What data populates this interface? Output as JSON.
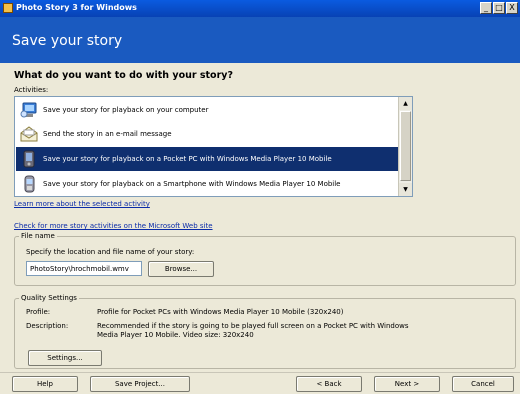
{
  "window": {
    "title": "Photo Story 3 for Windows",
    "controls": {
      "minimize": "_",
      "maximize": "□",
      "close": "X"
    }
  },
  "header": {
    "title": "Save your story"
  },
  "main": {
    "heading": "What do you want to do with your story?",
    "activities_label": "Activities:",
    "activities": [
      {
        "label": "Save your story for playback on your computer",
        "icon": "computer-icon",
        "selected": false
      },
      {
        "label": "Send the story in an e-mail message",
        "icon": "email-icon",
        "selected": false
      },
      {
        "label": "Save your story for playback on a Pocket PC with Windows Media Player 10 Mobile",
        "icon": "pocket-pc-icon",
        "selected": true
      },
      {
        "label": "Save your story for playback on a Smartphone with Windows Media Player 10 Mobile",
        "icon": "smartphone-icon",
        "selected": false
      }
    ],
    "learn_more_link": "Learn more about the selected activity",
    "check_more_link": "Check for more story activities on the Microsoft Web site"
  },
  "file_name": {
    "legend": "File name",
    "instruction": "Specify the location and file name of your story:",
    "value": "PhotoStory\\hrochmobil.wmv",
    "browse_label": "Browse..."
  },
  "quality": {
    "legend": "Quality Settings",
    "profile_label": "Profile:",
    "profile_value": "Profile for Pocket PCs with Windows Media Player 10 Mobile (320x240)",
    "description_label": "Description:",
    "description_value": "Recommended if the story is going to be played full screen on a Pocket PC with Windows Media Player 10 Mobile. Video size: 320x240",
    "settings_label": "Settings..."
  },
  "footer": {
    "help": "Help",
    "save_project": "Save Project...",
    "back": "< Back",
    "next": "Next >",
    "cancel": "Cancel"
  },
  "colors": {
    "header_bg": "#1a5ac0",
    "selection_bg": "#0f2f6f",
    "link": "#0a2ba8"
  }
}
